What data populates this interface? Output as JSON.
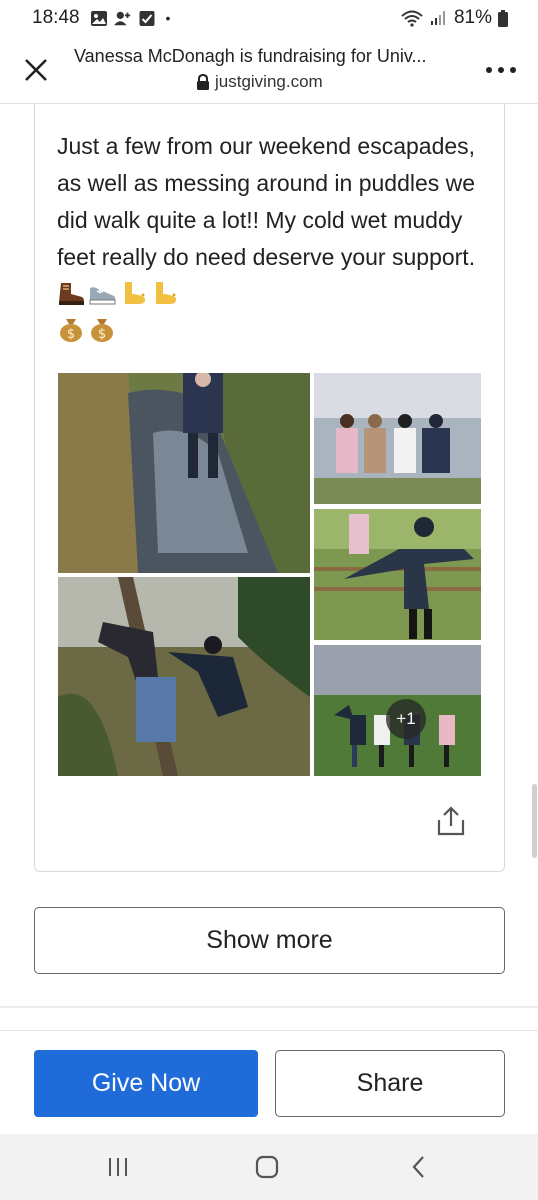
{
  "status_bar": {
    "time": "18:48",
    "battery": "81%",
    "icons": [
      "gallery-icon",
      "add-contact-icon",
      "checkbox-icon",
      "notification-dot-icon",
      "wifi-icon",
      "signal-icon",
      "battery-icon"
    ],
    "dot": "•"
  },
  "browser": {
    "title": "Vanessa McDonagh is fundraising for Univ...",
    "domain": "justgiving.com",
    "close_icon": "close-icon",
    "lock_icon": "lock-icon",
    "menu_icon": "more-vertical-icon"
  },
  "story": {
    "text": "Just a few from our weekend escapades, as well as messing around in puddles we did walk quite a lot!! My cold wet muddy feet really do need deserve your support.",
    "emojis": [
      "hiking-boot-emoji",
      "running-shoe-emoji",
      "foot-emoji",
      "foot-emoji",
      "money-bag-emoji",
      "money-bag-emoji"
    ]
  },
  "gallery": {
    "more_count": "+1",
    "photos": [
      "puddle-path-photo",
      "group-by-water-photo",
      "woman-arms-out-photo",
      "tree-climb-photo",
      "group-field-photo"
    ]
  },
  "actions": {
    "share_icon": "share-icon",
    "show_more": "Show more",
    "give_now": "Give Now",
    "share": "Share"
  },
  "colors": {
    "primary": "#1f6bd9",
    "border": "#d9d9d9"
  },
  "nav": {
    "recent_icon": "recent-apps-icon",
    "home_icon": "home-icon",
    "back_icon": "back-icon"
  }
}
